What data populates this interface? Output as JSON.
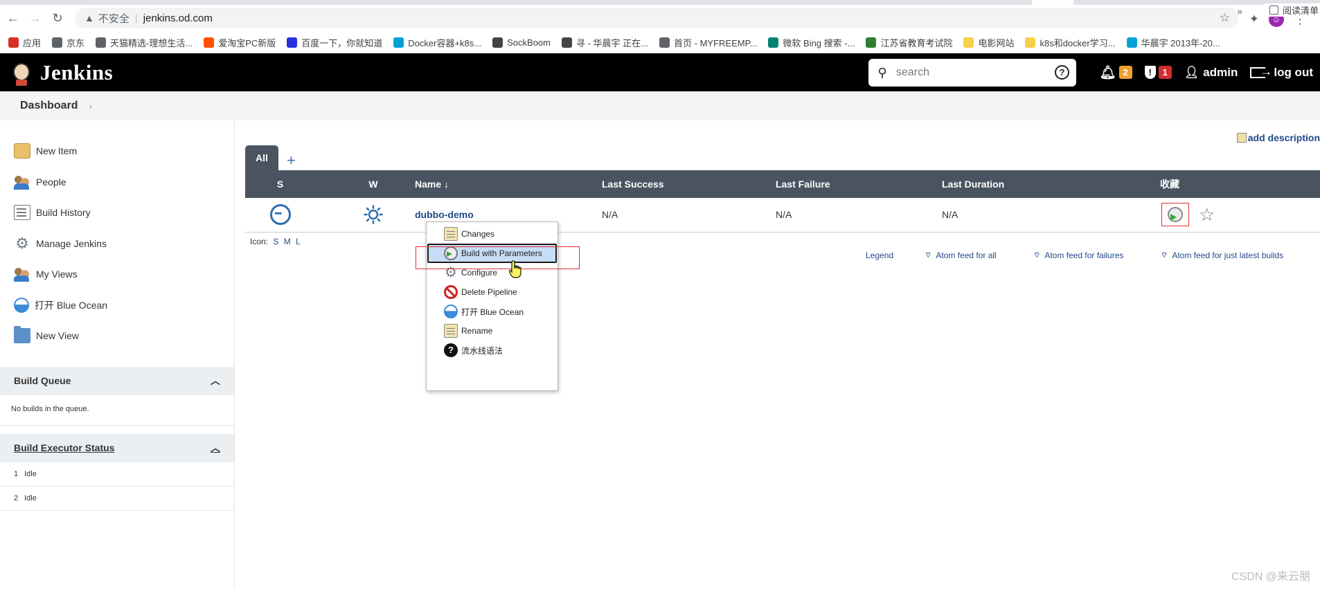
{
  "browser": {
    "security_label": "不安全",
    "url": "jenkins.od.com",
    "bookmarks": [
      {
        "label": "应用",
        "icon": "apps-grid-icon",
        "color": "#d93025"
      },
      {
        "label": "京东",
        "icon": "globe-icon",
        "color": "#5f6368"
      },
      {
        "label": "天猫精选-理想生活...",
        "icon": "globe-icon",
        "color": "#5f6368"
      },
      {
        "label": "爱淘宝PC新版",
        "icon": "taobao-icon",
        "color": "#ff5000"
      },
      {
        "label": "百度一下，你就知道",
        "icon": "baidu-icon",
        "color": "#2932e1"
      },
      {
        "label": "Docker容器+k8s...",
        "icon": "bilibili-icon",
        "color": "#00a1d6"
      },
      {
        "label": "SockBoom",
        "icon": "sockboom-icon",
        "color": "#444444"
      },
      {
        "label": "寻 - 华晨宇 正在...",
        "icon": "music-icon",
        "color": "#444444"
      },
      {
        "label": "首页 - MYFREEMP...",
        "icon": "globe-icon",
        "color": "#5f6368"
      },
      {
        "label": "微软 Bing 搜索 -...",
        "icon": "bing-icon",
        "color": "#008373"
      },
      {
        "label": "江苏省教育考试院",
        "icon": "edu-icon",
        "color": "#2e7d32"
      },
      {
        "label": "电影网站",
        "icon": "folder-icon",
        "color": "#f9ce4a"
      },
      {
        "label": "k8s和docker学习...",
        "icon": "folder-icon",
        "color": "#f9ce4a"
      },
      {
        "label": "华晨宇 2013年-20...",
        "icon": "bilibili-icon",
        "color": "#00a1d6"
      }
    ],
    "more": "»",
    "reading_list": "阅读清单"
  },
  "header": {
    "brand": "Jenkins",
    "search_placeholder": "search",
    "notifications_count": "2",
    "notifications_color": "#f0a030",
    "security_count": "1",
    "security_color": "#d42c2c",
    "user": "admin",
    "logout": "log out"
  },
  "breadcrumb": {
    "dashboard": "Dashboard"
  },
  "sidebar": {
    "tasks": [
      {
        "label": "New Item",
        "icon": "new-item-icon"
      },
      {
        "label": "People",
        "icon": "people-icon"
      },
      {
        "label": "Build History",
        "icon": "build-history-icon"
      },
      {
        "label": "Manage Jenkins",
        "icon": "gear-icon"
      },
      {
        "label": "My Views",
        "icon": "people-icon"
      },
      {
        "label": "打开 Blue Ocean",
        "icon": "blue-ocean-icon"
      },
      {
        "label": "New View",
        "icon": "folder-icon"
      }
    ],
    "build_queue": {
      "title": "Build Queue",
      "empty": "No builds in the queue."
    },
    "executors": {
      "title": "Build Executor Status",
      "rows": [
        {
          "num": "1",
          "status": "Idle"
        },
        {
          "num": "2",
          "status": "Idle"
        }
      ]
    }
  },
  "main": {
    "add_description": "add description",
    "tabs": {
      "all": "All",
      "add": "+"
    },
    "columns": {
      "s": "S",
      "w": "W",
      "name": "Name ↓",
      "last_success": "Last Success",
      "last_failure": "Last Failure",
      "last_duration": "Last Duration",
      "favorite": "收藏"
    },
    "jobs": [
      {
        "name": "dubbo-demo",
        "last_success": "N/A",
        "last_failure": "N/A",
        "last_duration": "N/A"
      }
    ],
    "icon_label": "Icon:",
    "icon_sizes": [
      "S",
      "M",
      "L"
    ],
    "legend": "Legend",
    "feeds": {
      "all": "Atom feed for all",
      "failures": "Atom feed for failures",
      "latest": "Atom feed for just latest builds"
    }
  },
  "context_menu": {
    "items": [
      {
        "label": "Changes",
        "icon": "notepad-icon"
      },
      {
        "label": "Build with Parameters",
        "icon": "build-clock-icon",
        "highlighted": true
      },
      {
        "label": "Configure",
        "icon": "gear-icon"
      },
      {
        "label": "Delete Pipeline",
        "icon": "no-entry-icon"
      },
      {
        "label": "打开 Blue Ocean",
        "icon": "blue-ocean-icon"
      },
      {
        "label": "Rename",
        "icon": "notepad-icon"
      },
      {
        "label": "流水线语法",
        "icon": "help-icon"
      }
    ]
  },
  "watermark": "CSDN @来云朋"
}
